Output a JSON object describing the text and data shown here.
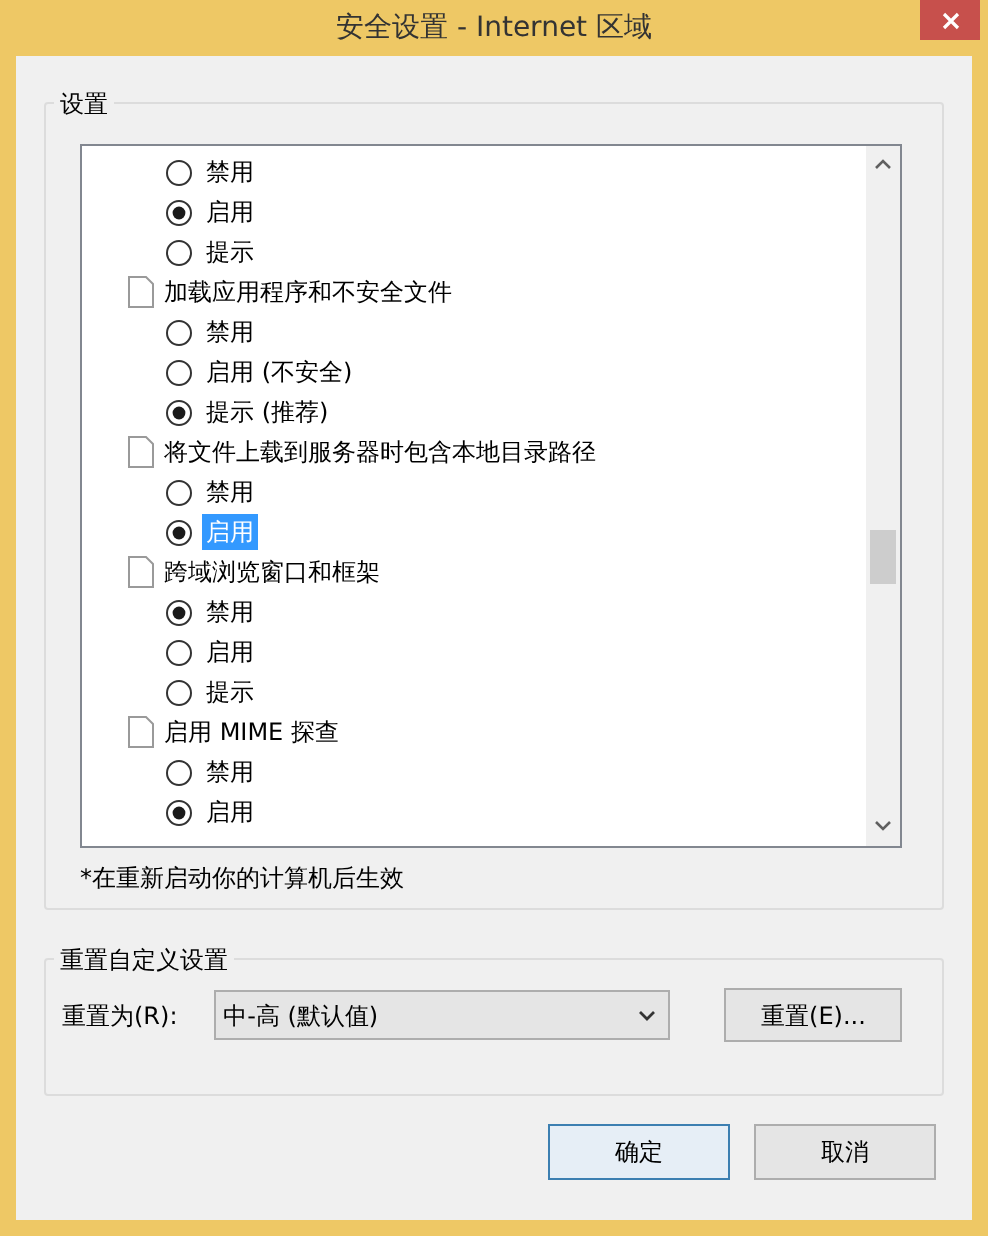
{
  "window": {
    "title": "安全设置 - Internet 区域"
  },
  "settings_group": {
    "title": "设置",
    "items": [
      {
        "kind": "radio",
        "label": "禁用",
        "selected": false,
        "focused": false
      },
      {
        "kind": "radio",
        "label": "启用",
        "selected": true,
        "focused": false
      },
      {
        "kind": "radio",
        "label": "提示",
        "selected": false,
        "focused": false
      },
      {
        "kind": "header",
        "label": "加载应用程序和不安全文件"
      },
      {
        "kind": "radio",
        "label": "禁用",
        "selected": false,
        "focused": false
      },
      {
        "kind": "radio",
        "label": "启用 (不安全)",
        "selected": false,
        "focused": false
      },
      {
        "kind": "radio",
        "label": "提示 (推荐)",
        "selected": true,
        "focused": false
      },
      {
        "kind": "header",
        "label": "将文件上载到服务器时包含本地目录路径"
      },
      {
        "kind": "radio",
        "label": "禁用",
        "selected": false,
        "focused": false
      },
      {
        "kind": "radio",
        "label": "启用",
        "selected": true,
        "focused": true
      },
      {
        "kind": "header",
        "label": "跨域浏览窗口和框架"
      },
      {
        "kind": "radio",
        "label": "禁用",
        "selected": true,
        "focused": false
      },
      {
        "kind": "radio",
        "label": "启用",
        "selected": false,
        "focused": false
      },
      {
        "kind": "radio",
        "label": "提示",
        "selected": false,
        "focused": false
      },
      {
        "kind": "header",
        "label": "启用 MIME 探查"
      },
      {
        "kind": "radio",
        "label": "禁用",
        "selected": false,
        "focused": false
      },
      {
        "kind": "radio",
        "label": "启用",
        "selected": true,
        "focused": false
      }
    ],
    "note": "*在重新启动你的计算机后生效"
  },
  "reset_group": {
    "title": "重置自定义设置",
    "label": "重置为(R):",
    "select_value": "中-高 (默认值)",
    "button": "重置(E)..."
  },
  "buttons": [
    {
      "label": "确定",
      "default": true
    },
    {
      "label": "取消",
      "default": false
    }
  ]
}
